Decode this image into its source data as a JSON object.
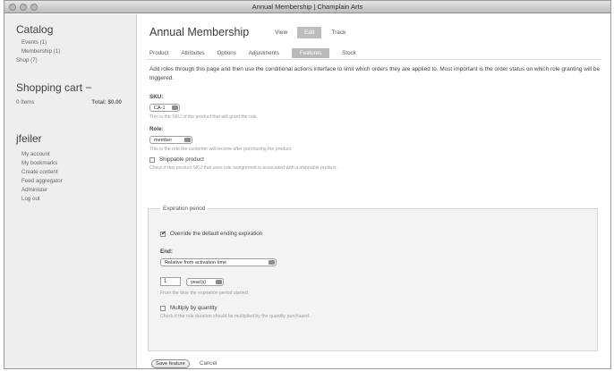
{
  "window": {
    "title": "Annual Membership | Champlain Arts"
  },
  "sidebar": {
    "catalog": {
      "heading": "Catalog",
      "items": [
        {
          "label": "Events (1)"
        },
        {
          "label": "Membership (1)"
        },
        {
          "label": "Shop (7)"
        }
      ]
    },
    "cart": {
      "heading": "Shopping cart −",
      "items_label": "0 Items",
      "total_label": "Total: $0.00"
    },
    "user": {
      "heading": "jfeiler",
      "items": [
        {
          "label": "My account"
        },
        {
          "label": "My bookmarks"
        },
        {
          "label": "Create content"
        },
        {
          "label": "Feed aggregator"
        },
        {
          "label": "Administer"
        },
        {
          "label": "Log out"
        }
      ]
    }
  },
  "main": {
    "title": "Annual Membership",
    "primary_tabs": [
      {
        "label": "View"
      },
      {
        "label": "Edit",
        "active": true
      },
      {
        "label": "Track"
      }
    ],
    "secondary_tabs": [
      {
        "label": "Product"
      },
      {
        "label": "Attributes"
      },
      {
        "label": "Options"
      },
      {
        "label": "Adjustments"
      },
      {
        "label": "Features",
        "active": true
      },
      {
        "label": "Stock"
      }
    ],
    "intro": "Add roles through this page and then use the conditional actions interface to limit which orders they are applied to. Most important is the order status on which role granting will be triggered.",
    "sku": {
      "label": "SKU:",
      "value": "CA-1",
      "description": "This is the SKU of the product that will grant the role."
    },
    "role": {
      "label": "Role:",
      "value": "member",
      "description": "This is the role the customer will receive after purchasing the product."
    },
    "shippable": {
      "label": "Shippable product",
      "checked": false,
      "description": "Check if this product SKU that uses role assignment is associated with a shippable product."
    },
    "expiration": {
      "legend": "Expiration period",
      "override": {
        "label": "Override the default ending expiration",
        "checked": true
      },
      "end": {
        "label": "End:",
        "value": "Relative from activation time"
      },
      "qty": {
        "value": "1"
      },
      "unit": {
        "value": "year(s)"
      },
      "qty_description": "From the time the expiration period started.",
      "multiply": {
        "label": "Multiply by quantity",
        "checked": false,
        "description": "Check if the role duration should be multiplied by the quantity purchased."
      }
    },
    "actions": {
      "save_label": "Save feature",
      "cancel_label": "Cancel"
    }
  }
}
